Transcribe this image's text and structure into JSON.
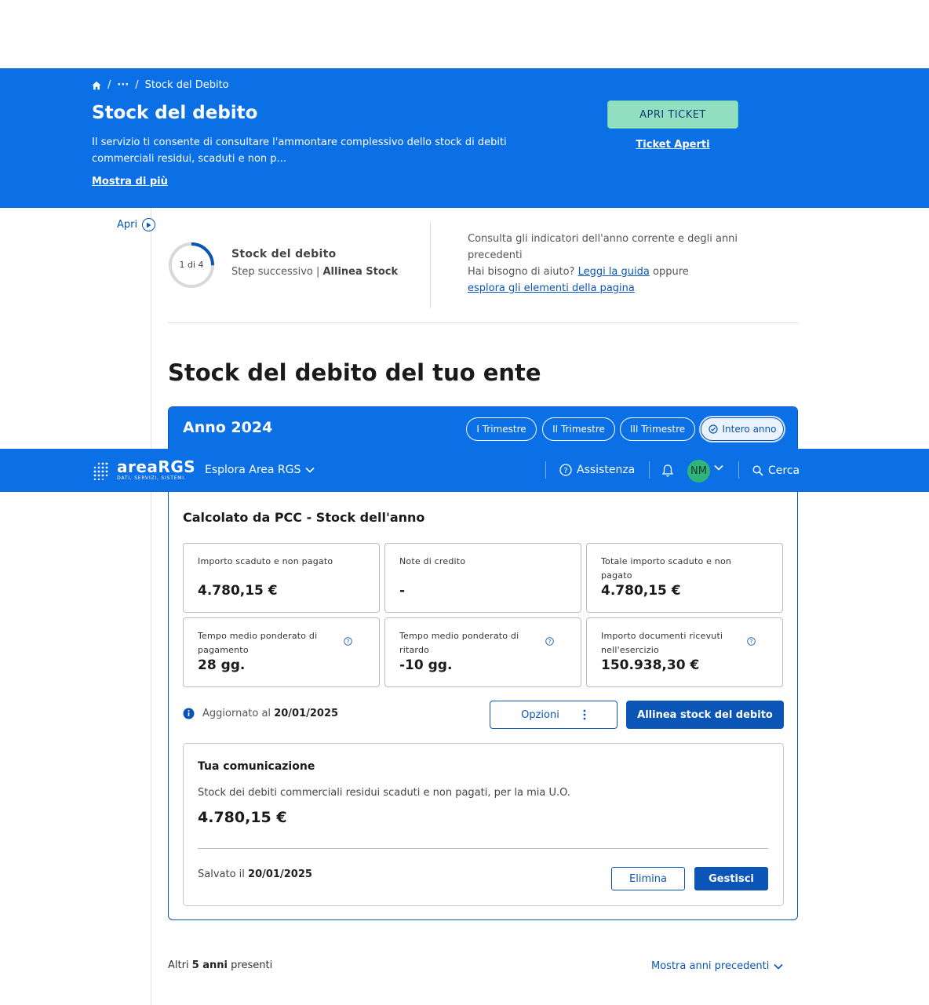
{
  "hero": {
    "breadcrumb_ellipsis": "···",
    "breadcrumb_sep": "/",
    "breadcrumb_current": "Stock del Debito",
    "title": "Stock del debito",
    "description": "Il servizio ti consente di consultare l'ammontare complessivo dello stock di debiti commerciali residui, scaduti e non p...",
    "more_link": "Mostra di più",
    "ticket_button": "APRI TICKET",
    "ticket_link": "Ticket Aperti",
    "bg_color": "#0b6fe6"
  },
  "sidebar": {
    "toggle_label": "Apri"
  },
  "step": {
    "counter": "1 di 4",
    "progress": 0.25,
    "title": "Stock del debito",
    "next_prefix": "Step successivo |",
    "next_name": "Allinea Stock"
  },
  "help": {
    "line1": "Consulta gli indicatori dell'anno corrente e degli anni precedenti",
    "line2_prefix": "Hai bisogno di aiuto?",
    "guide_link": "Leggi la guida",
    "line2_suffix": "oppure",
    "explore_link": "esplora gli elementi della pagina"
  },
  "section_title": "Stock del debito del tuo ente",
  "year_card": {
    "title": "Anno 2024",
    "chips": [
      "I Trimestre",
      "II Trimestre",
      "III Trimestre",
      "Intero anno"
    ],
    "active_chip": "Intero anno",
    "calc_title": "Calcolato da PCC - Stock dell'anno",
    "kpis": [
      {
        "label": "Importo scaduto e non pagato",
        "value": "4.780,15 €"
      },
      {
        "label": "Note di credito",
        "value": "-"
      },
      {
        "label": "Totale importo scaduto e non pagato",
        "value": "4.780,15 €"
      },
      {
        "label": "Tempo medio ponderato di pagamento",
        "value": "28 gg."
      },
      {
        "label": "Tempo medio ponderato di ritardo",
        "value": "-10 gg."
      },
      {
        "label": "Importo documenti ricevuti nell'esercizio",
        "value": "150.938,30 €"
      }
    ],
    "updated_prefix": "Aggiornato al",
    "updated_date": "20/01/2025",
    "options_button": "Opzioni",
    "align_button": "Allinea stock del debito",
    "communication": {
      "title": "Tua comunicazione",
      "description": "Stock dei debiti commerciali residui scaduti e non pagati, per la mia U.O.",
      "value": "4.780,15 €",
      "saved_prefix": "Salvato il",
      "saved_date": "20/01/2025",
      "delete_button": "Elimina",
      "manage_button": "Gestisci"
    }
  },
  "appbar": {
    "logo_name": "areaRGS",
    "logo_sub": "DATI, SERVIZI, SISTEMI.",
    "explore": "Esplora Area RGS",
    "assist": "Assistenza",
    "avatar_initials": "NM",
    "search": "Cerca"
  },
  "footer": {
    "others_prefix": "Altri",
    "others_count": "5 anni",
    "others_suffix": "presenti",
    "prev_years_link": "Mostra anni precedenti"
  },
  "colors": {
    "primary": "#0b6fe6",
    "primary_dark": "#0b55b6",
    "ticket_green": "#93dfc2",
    "avatar_green": "#2fb47a"
  }
}
